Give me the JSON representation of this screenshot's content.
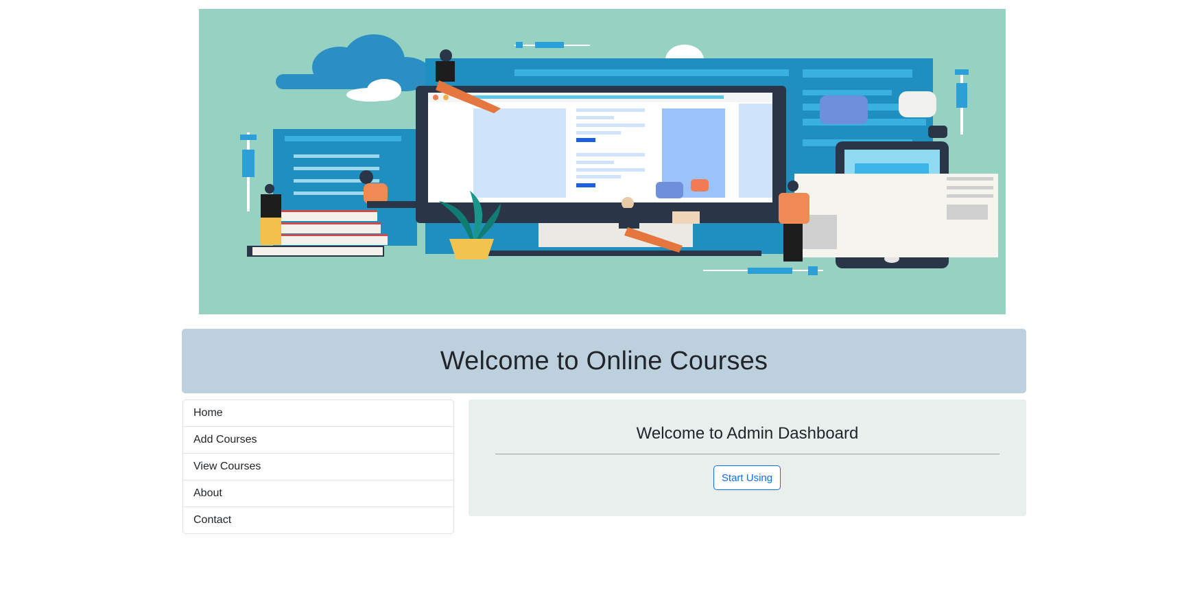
{
  "hero": {
    "image_name": "online-courses-illustration"
  },
  "header": {
    "title": "Welcome to Online Courses"
  },
  "sidebar": {
    "items": [
      {
        "label": "Home"
      },
      {
        "label": "Add Courses"
      },
      {
        "label": "View Courses"
      },
      {
        "label": "About"
      },
      {
        "label": "Contact"
      }
    ]
  },
  "main": {
    "heading": "Welcome to Admin Dashboard",
    "button_label": "Start Using"
  },
  "colors": {
    "hero_bg": "#95d2c2",
    "title_bg": "#bdd0dd",
    "panel_bg": "#e9efec",
    "accent": "#0d6efd"
  }
}
